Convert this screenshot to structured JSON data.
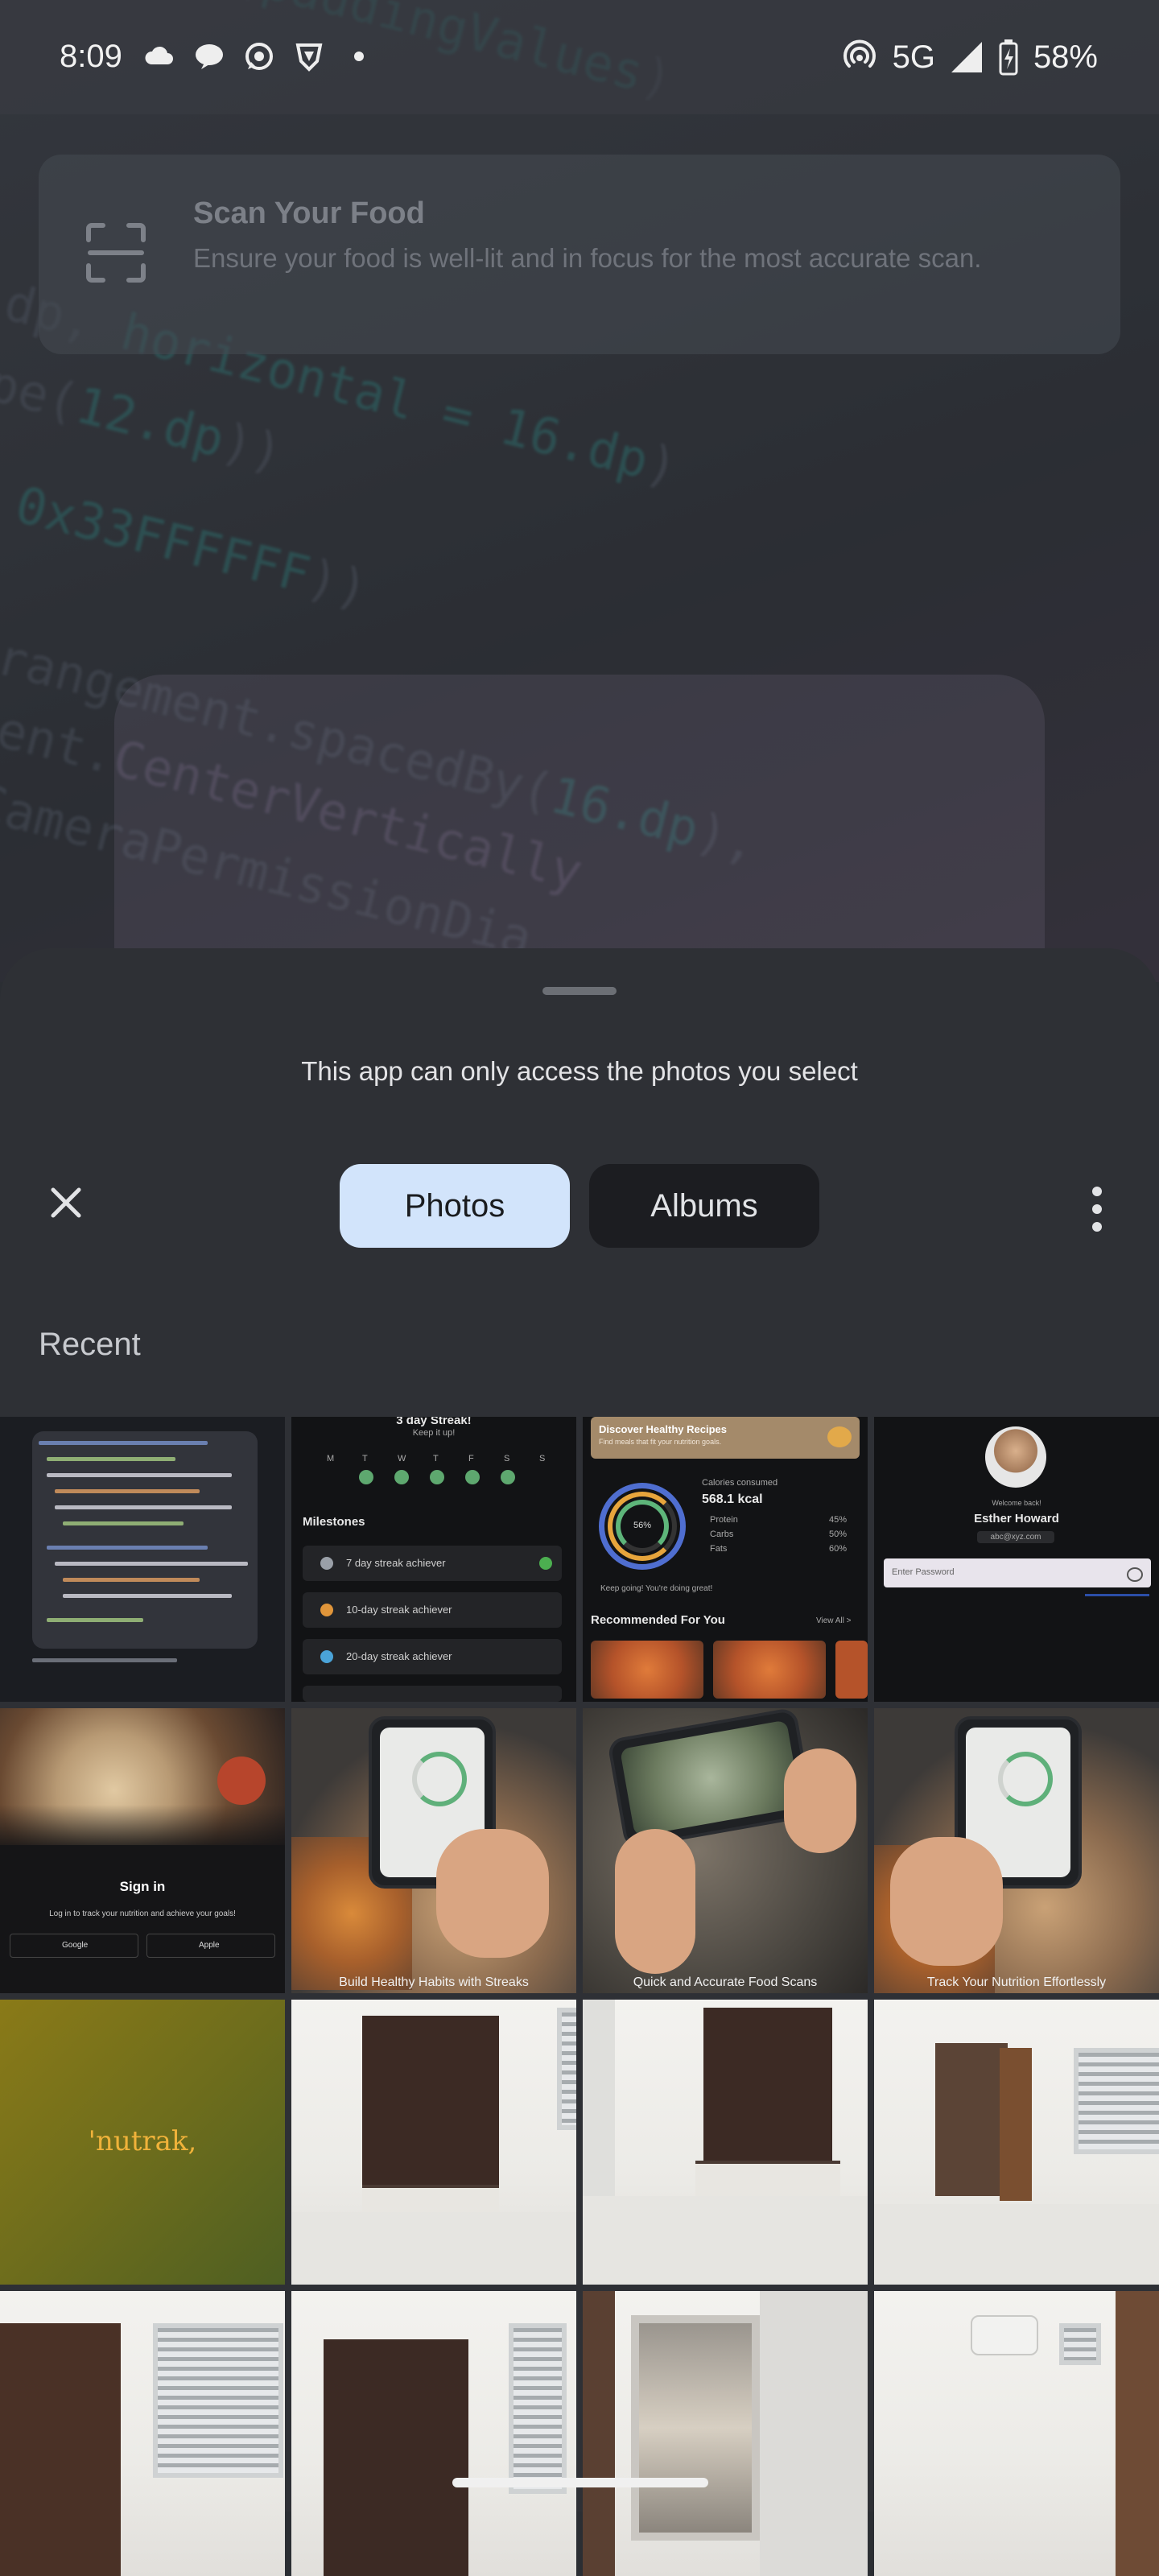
{
  "status_bar": {
    "time": "8:09",
    "network": "5G",
    "battery": "58%",
    "left_icons": [
      "cloud-sync-icon",
      "chat-bubble-icon",
      "whatsapp-icon",
      "vpn-shield-icon",
      "dot-icon"
    ],
    "right_icons": [
      "hotspot-icon",
      "signal-icon",
      "battery-charging-icon"
    ]
  },
  "camera_overlay": {
    "scan_title": "Scan Your Food",
    "scan_description": "Ensure your food is well-lit and in focus for the most accurate scan."
  },
  "picker": {
    "access_note": "This app can only access the photos you select",
    "tabs": {
      "photos": "Photos",
      "albums": "Albums"
    },
    "section_title": "Recent",
    "close_icon": "close-icon",
    "more_icon": "more-vert-icon"
  },
  "thumbnails": {
    "streak": {
      "header": "3 day Streak!",
      "sub": "Keep it up!",
      "milestones_title": "Milestones",
      "days": [
        "M",
        "T",
        "W",
        "T",
        "F",
        "S",
        "S"
      ],
      "items": [
        "7 day streak achiever",
        "10-day streak achiever",
        "20-day streak achiever"
      ]
    },
    "recipes": {
      "banner_title": "Discover Healthy Recipes",
      "banner_sub": "Find meals that fit your nutrition goals.",
      "calories_label": "Calories consumed",
      "calories_value": "568.1 kcal",
      "ring_center": "56%",
      "macros": [
        {
          "name": "Protein",
          "pct": "45%"
        },
        {
          "name": "Carbs",
          "pct": "50%"
        },
        {
          "name": "Fats",
          "pct": "60%"
        }
      ],
      "encourage": "Keep going! You're doing great!",
      "recommended": "Recommended For You",
      "view_all": "View All >"
    },
    "login": {
      "welcome": "Welcome back!",
      "name": "Esther Howard",
      "email": "abc@xyz.com",
      "password_placeholder": "Enter Password"
    },
    "signin": {
      "title": "Sign in",
      "sub": "Log in to track your nutrition and achieve your goals!",
      "google": "Google",
      "apple": "Apple"
    },
    "onboard_captions": [
      "Build Healthy Habits with Streaks",
      "Quick and Accurate Food Scans",
      "Track Your Nutrition Effortlessly"
    ],
    "brand_logo": "'nutrak,"
  }
}
